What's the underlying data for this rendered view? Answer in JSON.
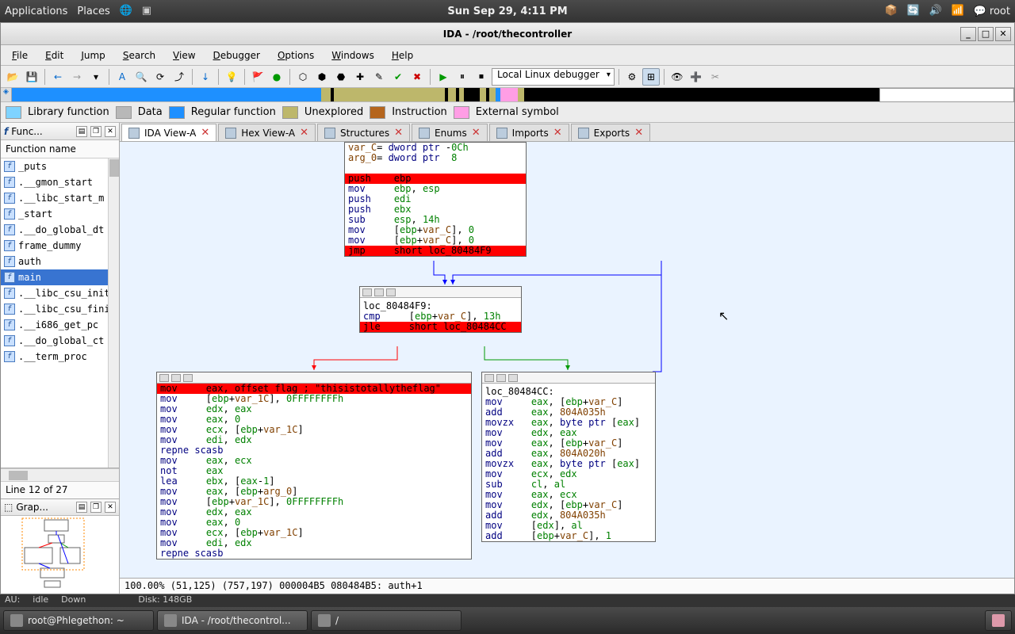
{
  "sysbar": {
    "apps": "Applications",
    "places": "Places",
    "clock": "Sun Sep 29,  4:11 PM",
    "user": "root"
  },
  "window": {
    "title": "IDA - /root/thecontroller"
  },
  "menus": [
    "File",
    "Edit",
    "Jump",
    "Search",
    "View",
    "Debugger",
    "Options",
    "Windows",
    "Help"
  ],
  "debugger_combo": "Local Linux debugger",
  "legend": [
    {
      "color": "#7fd3ff",
      "label": "Library function"
    },
    {
      "color": "#b8b8b8",
      "label": "Data"
    },
    {
      "color": "#1e90ff",
      "label": "Regular function"
    },
    {
      "color": "#bdb76b",
      "label": "Unexplored"
    },
    {
      "color": "#b5651d",
      "label": "Instruction"
    },
    {
      "color": "#ff9ee5",
      "label": "External symbol"
    }
  ],
  "left": {
    "functions_title": "Func...",
    "header": "Function name",
    "items": [
      "_puts",
      ".__gmon_start",
      ".__libc_start_m",
      "_start",
      ".__do_global_dt",
      "frame_dummy",
      "auth",
      "main",
      ".__libc_csu_init",
      ".__libc_csu_fini",
      ".__i686_get_pc",
      ".__do_global_ct",
      ".__term_proc"
    ],
    "selected": "main",
    "line_status": "Line 12 of 27",
    "graph_title": "Grap..."
  },
  "tabs": [
    {
      "label": "IDA View-A",
      "active": true
    },
    {
      "label": "Hex View-A"
    },
    {
      "label": "Structures"
    },
    {
      "label": "Enums"
    },
    {
      "label": "Imports"
    },
    {
      "label": "Exports"
    }
  ],
  "node_top": {
    "pre": [
      "var_C= dword ptr -0Ch",
      "arg_0= dword ptr  8",
      ""
    ],
    "red1": "push    ebp",
    "body": [
      [
        "mov",
        "ebp, esp"
      ],
      [
        "push",
        "edi"
      ],
      [
        "push",
        "ebx"
      ],
      [
        "sub",
        "esp, 14h"
      ],
      [
        "mov",
        "[ebp+var_C], 0"
      ],
      [
        "mov",
        "[ebp+var_C], 0"
      ]
    ],
    "red2": "jmp     short loc_80484F9"
  },
  "node_cmp": {
    "label": "loc_80484F9:",
    "l1": [
      "cmp",
      "[ebp+var_C], 13h"
    ],
    "red": "jle     short loc_80484CC"
  },
  "node_left": {
    "red": "mov     eax, offset flag ; \"thisistotallytheflag\"",
    "body": [
      [
        "mov",
        "[ebp+var_1C], 0FFFFFFFFh"
      ],
      [
        "mov",
        "edx, eax"
      ],
      [
        "mov",
        "eax, 0"
      ],
      [
        "mov",
        "ecx, [ebp+var_1C]"
      ],
      [
        "mov",
        "edi, edx"
      ],
      [
        "repne scasb",
        ""
      ],
      [
        "mov",
        "eax, ecx"
      ],
      [
        "not",
        "eax"
      ],
      [
        "lea",
        "ebx, [eax-1]"
      ],
      [
        "mov",
        "eax, [ebp+arg_0]"
      ],
      [
        "mov",
        "[ebp+var_1C], 0FFFFFFFFh"
      ],
      [
        "mov",
        "edx, eax"
      ],
      [
        "mov",
        "eax, 0"
      ],
      [
        "mov",
        "ecx, [ebp+var_1C]"
      ],
      [
        "mov",
        "edi, edx"
      ],
      [
        "repne scasb",
        ""
      ]
    ]
  },
  "node_right": {
    "label": "loc_80484CC:",
    "body": [
      [
        "mov",
        "eax, [ebp+var_C]"
      ],
      [
        "add",
        "eax, 804A035h",
        true
      ],
      [
        "movzx",
        "eax, byte ptr [eax]"
      ],
      [
        "mov",
        "edx, eax"
      ],
      [
        "mov",
        "eax, [ebp+var_C]"
      ],
      [
        "add",
        "eax, 804A020h",
        true
      ],
      [
        "movzx",
        "eax, byte ptr [eax]"
      ],
      [
        "mov",
        "ecx, edx"
      ],
      [
        "sub",
        "cl, al"
      ],
      [
        "mov",
        "eax, ecx"
      ],
      [
        "mov",
        "edx, [ebp+var_C]"
      ],
      [
        "add",
        "edx, 804A035h",
        true
      ],
      [
        "mov",
        "[edx], al"
      ],
      [
        "add",
        "[ebp+var_C], 1"
      ]
    ]
  },
  "statusbar": "100.00% (51,125) (757,197) 000004B5 080484B5: auth+1",
  "bottom_status": {
    "au": "AU:",
    "idle": "idle",
    "down": "Down",
    "disk": "Disk:  148GB"
  },
  "tasks": [
    {
      "label": "root@Phlegethon: ~"
    },
    {
      "label": "IDA - /root/thecontrol...",
      "active": true
    },
    {
      "label": "/"
    }
  ]
}
